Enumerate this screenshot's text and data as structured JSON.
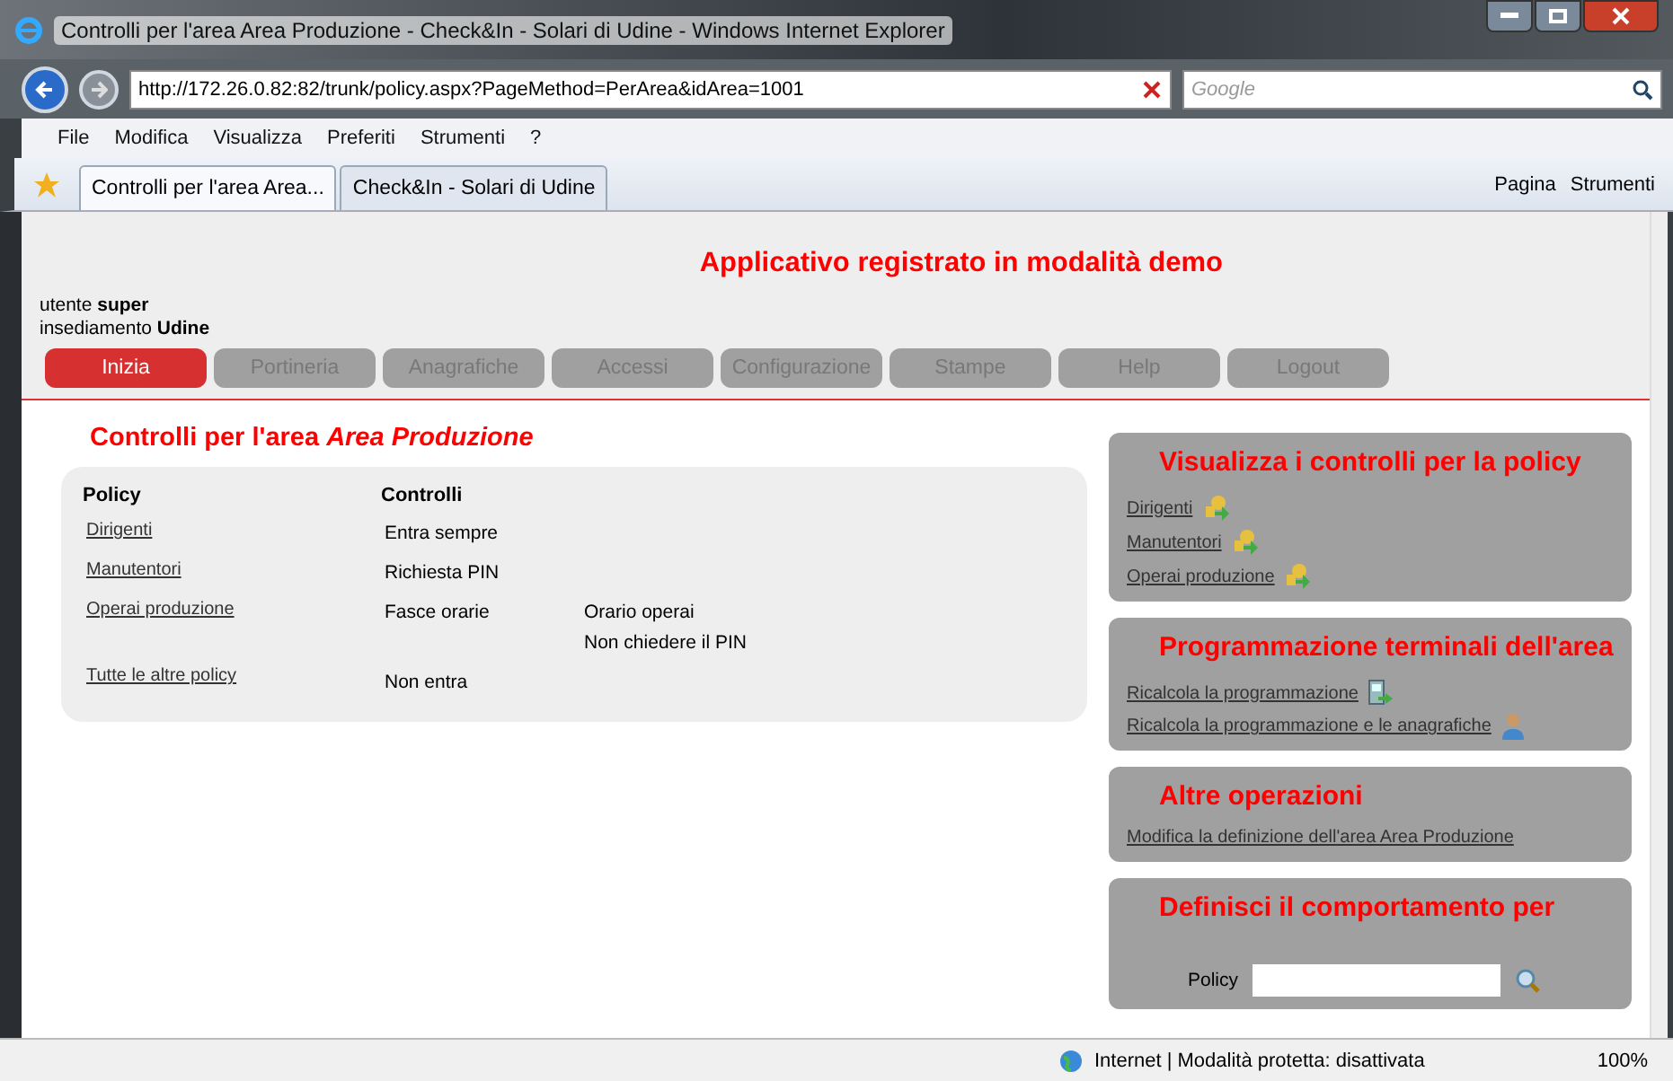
{
  "window": {
    "title": "Controlli per l'area Area Produzione - Check&In - Solari di Udine - Windows Internet Explorer"
  },
  "address_bar": {
    "url": "http://172.26.0.82:82/trunk/policy.aspx?PageMethod=PerArea&idArea=1001",
    "search_placeholder": "Google"
  },
  "menu": [
    "File",
    "Modifica",
    "Visualizza",
    "Preferiti",
    "Strumenti",
    "?"
  ],
  "tabs": [
    {
      "label": "Controlli per l'area Area...",
      "selected": true
    },
    {
      "label": "Check&In - Solari di Udine",
      "selected": false
    }
  ],
  "command_bar": [
    "Pagina",
    "Strumenti"
  ],
  "page": {
    "demo_notice": "Applicativo registrato in modalità demo",
    "user": "utente **super**",
    "site": "insediamento **Udine**",
    "nav": [
      {
        "label": "Inizia",
        "selected": true
      },
      {
        "label": "Portineria",
        "selected": false
      },
      {
        "label": "Anagrafiche",
        "selected": false
      },
      {
        "label": "Accessi",
        "selected": false
      },
      {
        "label": "Configurazione",
        "selected": false
      },
      {
        "label": "Stampe",
        "selected": false
      },
      {
        "label": "Help",
        "selected": false
      },
      {
        "label": "Logout",
        "selected": false
      }
    ],
    "heading": "Controlli per l'area *Area Produzione*",
    "table": {
      "columns": [
        "Policy",
        "Controlli"
      ],
      "rows": [
        {
          "policy": "Dirigenti",
          "control": "Entra sempre",
          "details": []
        },
        {
          "policy": "Manutentori",
          "control": "Richiesta PIN",
          "details": []
        },
        {
          "policy": "Operai produzione",
          "control": "Fasce orarie",
          "details": [
            "Orario operai",
            "Non chiedere il PIN"
          ]
        },
        {
          "policy": "Tutte le altre policy",
          "control": "Non entra",
          "details": []
        }
      ]
    },
    "panels": [
      {
        "title": "Visualizza i controlli per la policy",
        "links": [
          {
            "label": "Dirigenti",
            "kind": "keys"
          },
          {
            "label": "Manutentori",
            "kind": "keys"
          },
          {
            "label": "Operai produzione",
            "kind": "keys"
          }
        ]
      },
      {
        "title": "Programmazione terminali dell'area",
        "links": [
          {
            "label": "Ricalcola la programmazione",
            "kind": "terminal"
          },
          {
            "label": "Ricalcola la programmazione e le anagrafiche",
            "kind": "person"
          }
        ]
      },
      {
        "title": "Altre operazioni",
        "links": [
          {
            "label": "Modifica la definizione dell'area Area Produzione",
            "kind": "plain"
          }
        ]
      },
      {
        "title": "Definisci il comportamento per",
        "field_label": "Policy"
      }
    ]
  },
  "status_bar": {
    "zone": "Internet | Modalità protetta: disattivata",
    "zoom": "100%"
  }
}
